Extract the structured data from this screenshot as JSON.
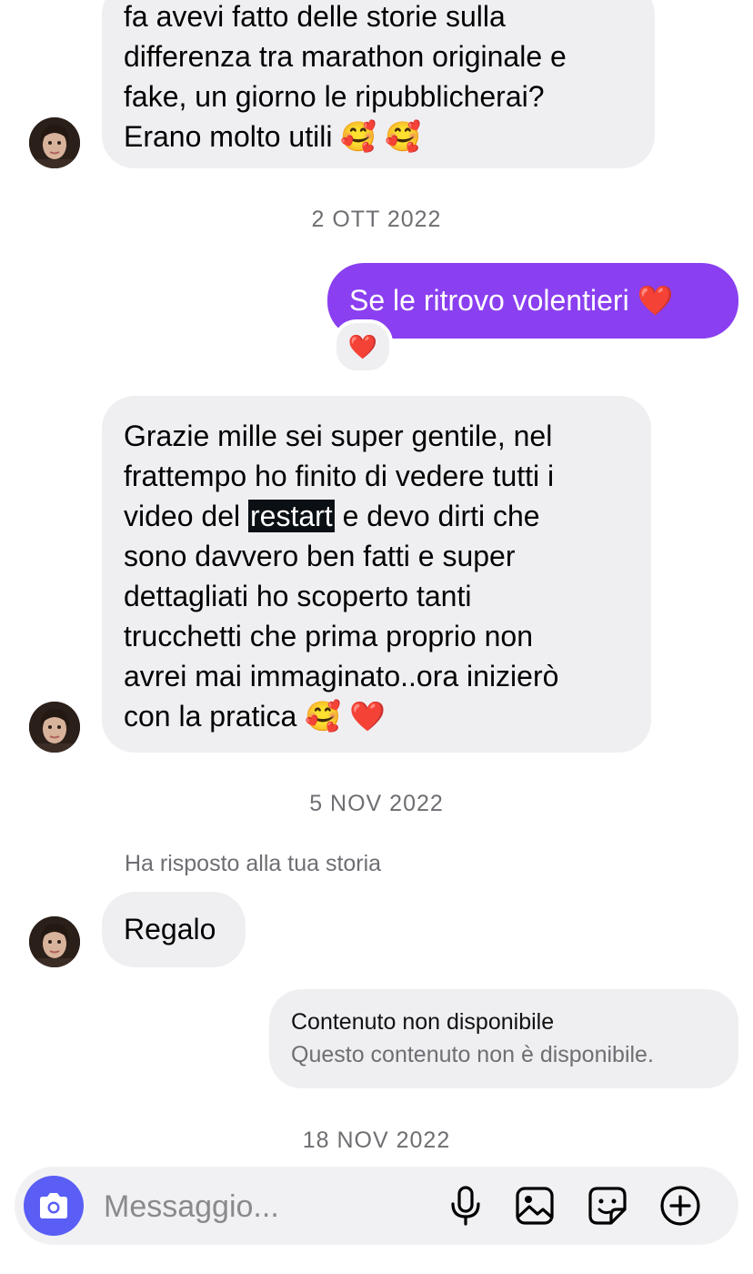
{
  "messages": {
    "m1_lines": [
      "fa avevi fatto delle storie sulla",
      "differenza tra marathon originale e",
      "fake, un giorno le ripubblicherai?",
      "Erano molto utili 🥰 🥰"
    ],
    "date1": "2 OTT 2022",
    "m2_text": "Se le ritrovo volentieri ❤️",
    "m2_reaction": "❤️",
    "m3": {
      "l1": "Grazie mille sei super gentile, nel",
      "l2": "frattempo ho finito di vedere tutti i",
      "l3_pre": "video del ",
      "l3_sel": "restart",
      "l3_post": " e devo dirti che",
      "l4": "sono davvero ben fatti e super",
      "l5": "dettagliati ho scoperto tanti",
      "l6": "trucchetti che prima proprio non",
      "l7": "avrei mai immaginato..ora inizierò",
      "l8": "con la pratica 🥰 ❤️"
    },
    "date2": "5 NOV 2022",
    "story_reply_label": "Ha risposto alla tua storia",
    "m4_text": "Regalo",
    "unavailable_title": "Contenuto non disponibile",
    "unavailable_subtitle": "Questo contenuto non è disponibile.",
    "date3": "18 NOV 2022"
  },
  "composer": {
    "placeholder": "Messaggio...",
    "camera_icon": "camera-icon",
    "tools": [
      "microphone-icon",
      "image-icon",
      "sticker-icon",
      "add-icon"
    ]
  },
  "colors": {
    "outgoing_bubble": "#8a3ff0",
    "incoming_bubble": "#efeff2",
    "camera_button": "#5a5ef5",
    "meta_text": "#6e6e73"
  }
}
